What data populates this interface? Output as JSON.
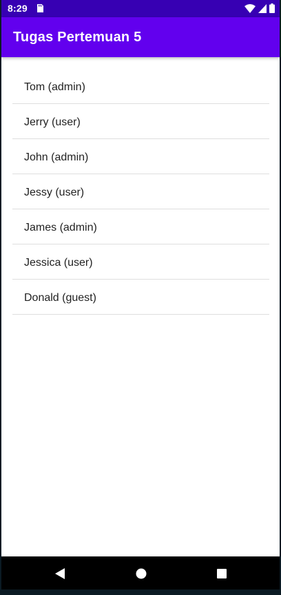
{
  "status_bar": {
    "time": "8:29",
    "icons": [
      "sd-card-icon",
      "wifi-icon",
      "signal-icon",
      "battery-icon"
    ]
  },
  "app_bar": {
    "title": "Tugas Pertemuan 5",
    "color": "#6200ee"
  },
  "users": [
    {
      "label": "Tom (admin)"
    },
    {
      "label": "Jerry (user)"
    },
    {
      "label": "John (admin)"
    },
    {
      "label": "Jessy (user)"
    },
    {
      "label": "James (admin)"
    },
    {
      "label": "Jessica (user)"
    },
    {
      "label": "Donald (guest)"
    }
  ],
  "nav_bar": {
    "buttons": [
      "back-icon",
      "home-icon",
      "recents-icon"
    ]
  },
  "colors": {
    "status_bar": "#3700b3",
    "app_bar": "#6200ee",
    "divider": "#dedede",
    "text": "#222222"
  }
}
